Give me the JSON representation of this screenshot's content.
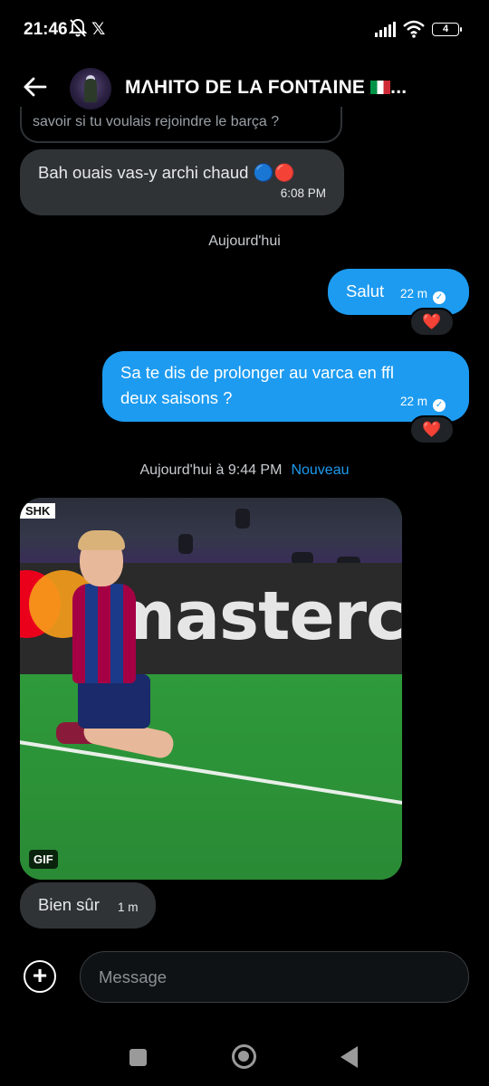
{
  "status_bar": {
    "time": "21:46",
    "battery": "4",
    "x_glyph": "𝕏",
    "icons": [
      "bell-off-icon",
      "x-logo-icon",
      "signal-icon",
      "wifi-icon",
      "battery-icon"
    ]
  },
  "header": {
    "title": "MΛHITO DE LA FONTAINE",
    "title_ellipsis": "...",
    "flag": "italy-flag-icon"
  },
  "messages": {
    "partial_text": "savoir si tu voulais rejoindre le barça ?",
    "m1": {
      "text": "Bah ouais vas-y archi chaud 🔵🔴",
      "time": "6:08 PM"
    },
    "day1": "Aujourd'hui",
    "m2": {
      "text": "Salut",
      "time": "22 m",
      "reaction": "❤️"
    },
    "m3": {
      "text": "Sa te dis de prolonger au varca en ffl deux saisons ?",
      "time": "22 m",
      "reaction": "❤️"
    },
    "day2": "Aujourd'hui à 9:44 PM",
    "new_label": "Nouveau",
    "gif": {
      "badge": "GIF",
      "board_text": "masterc",
      "tag": "SHK"
    },
    "m4": {
      "text": "Bien sûr",
      "time": "1 m"
    }
  },
  "composer": {
    "plus": "+",
    "placeholder": "Message"
  },
  "colors": {
    "accent": "#1d9bf0",
    "incoming_bubble": "#2f3336",
    "background": "#000000"
  }
}
